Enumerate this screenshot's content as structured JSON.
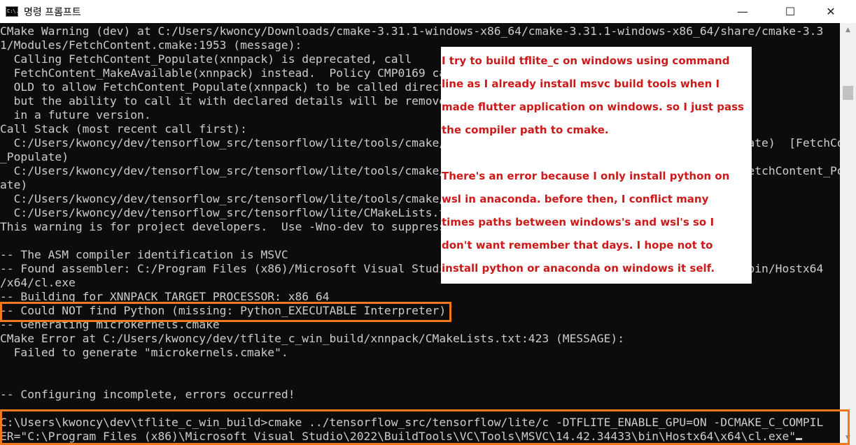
{
  "window": {
    "title": "명령 프롬프트",
    "icon_label": "C:\\.",
    "minimize_glyph": "—",
    "maximize_glyph": "☐",
    "close_glyph": "✕"
  },
  "terminal": {
    "lines": [
      "CMake Warning (dev) at C:/Users/kwoncy/Downloads/cmake-3.31.1-windows-x86_64/cmake-3.31.1-windows-x86_64/share/cmake-3.3",
      "1/Modules/FetchContent.cmake:1953 (message):",
      "  Calling FetchContent_Populate(xnnpack) is deprecated, call",
      "  FetchContent_MakeAvailable(xnnpack) instead.  Policy CMP0169 can be set to",
      "  OLD to allow FetchContent_Populate(xnnpack) to be called directly for now,",
      "  but the ability to call it with declared details will be removed completely",
      "  in a future version.",
      "Call Stack (most recent call first):",
      "  C:/Users/kwoncy/dev/tensorflow_src/tensorflow/lite/tools/cmake/modules/xnnpack.cmake:38 (FetchContent_Populate)  [FetchContent",
      "_Populate)",
      "  C:/Users/kwoncy/dev/tensorflow_src/tensorflow/lite/tools/cmake/modules/OverridableFetchContent.cmake:487 (FetchContent_Popul",
      "ate)",
      "  C:/Users/kwoncy/dev/tensorflow_src/tensorflow/lite/tools/cmake/modules/xnnpack.cmake:22 (include)",
      "  C:/Users/kwoncy/dev/tensorflow_src/tensorflow/lite/CMakeLists.txt:197 (find_package)",
      "This warning is for project developers.  Use -Wno-dev to suppress it.",
      "",
      "-- The ASM compiler identification is MSVC",
      "-- Found assembler: C:/Program Files (x86)/Microsoft Visual Studio/2022/BuildTools/VC/Tools/MSVC/14.42.34433/bin/Hostx64",
      "/x64/cl.exe",
      "-- Building for XNNPACK_TARGET_PROCESSOR: x86_64",
      "-- Could NOT find Python (missing: Python_EXECUTABLE Interpreter)",
      "-- Generating microkernels.cmake",
      "CMake Error at C:/Users/kwoncy/dev/tflite_c_win_build/xnnpack/CMakeLists.txt:423 (MESSAGE):",
      "  Failed to generate \"microkernels.cmake\".",
      "",
      "",
      "-- Configuring incomplete, errors occurred!",
      "",
      "",
      "C:\\Users\\kwoncy\\dev\\tflite_c_win_build>cmake ../tensorflow_src/tensorflow/lite/c -DTFLITE_ENABLE_GPU=ON -DCMAKE_C_COMPIL",
      "ER=\"C:\\Program Files (x86)\\Microsoft Visual Studio\\2022\\BuildTools\\VC\\Tools\\MSVC\\14.42.34433\\bin\\Hostx64\\x64\\cl.exe\""
    ]
  },
  "annotation": {
    "lines": [
      "I try to build tflite_c on windows using command",
      "line as I already install msvc build tools when I",
      "made flutter application on windows. so I just pass",
      "the compiler path to cmake.",
      "",
      "There's an error because I only install python on",
      "wsl in anaconda. before then, I conflict many",
      "times paths between windows's and wsl's so I",
      "don't want remember that days. I hope not to",
      "install python or anaconda on windows it self."
    ]
  },
  "colors": {
    "terminal_bg": "#0c0c0c",
    "terminal_text": "#cccccc",
    "annotation_text": "#cc1a1a",
    "highlight_border": "#f0781e"
  }
}
